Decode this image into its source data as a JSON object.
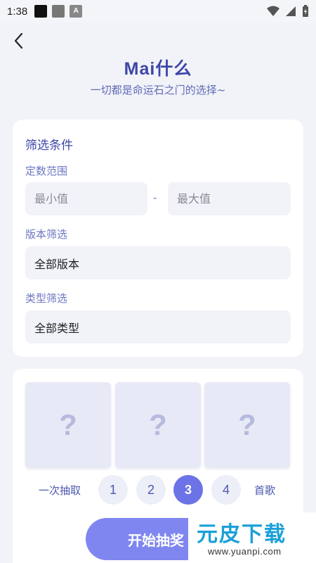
{
  "status_bar": {
    "time": "1:38",
    "a_icon_text": "A"
  },
  "header": {
    "title": "Mai什么",
    "subtitle": "一切都是命运石之门的选择~"
  },
  "filter": {
    "heading": "筛选条件",
    "level_range_label": "定数范围",
    "min_placeholder": "最小值",
    "separator": "-",
    "max_placeholder": "最大值",
    "version_label": "版本筛选",
    "version_value": "全部版本",
    "type_label": "类型筛选",
    "type_value": "全部类型"
  },
  "draw": {
    "slots": [
      "?",
      "?",
      "?"
    ],
    "count_label": "一次抽取",
    "counts": [
      "1",
      "2",
      "3",
      "4"
    ],
    "selected_count": "3",
    "count_suffix": "首歌",
    "start_button": "开始抽奖"
  },
  "watermark": {
    "brand": "元皮下载",
    "url": "www.yuanpi.com"
  },
  "colors": {
    "accent": "#6c73e6",
    "title": "#3d46a8",
    "background": "#f2f3f8"
  }
}
